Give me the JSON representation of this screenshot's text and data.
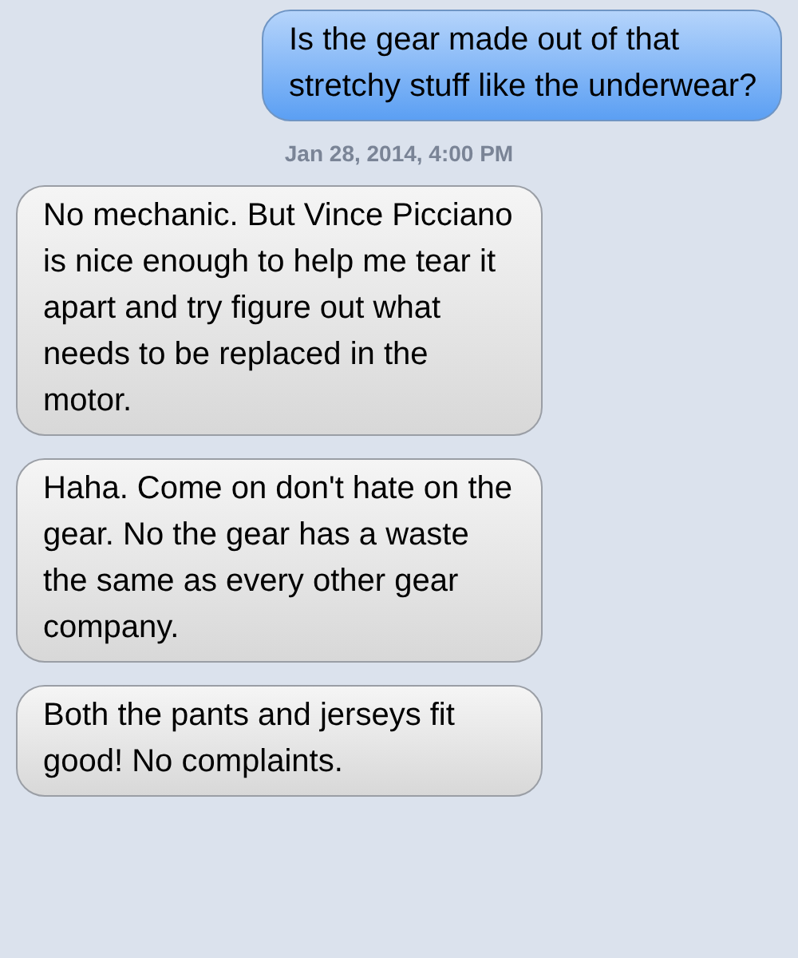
{
  "messages": [
    {
      "kind": "sent",
      "text": "Is the gear made out of that stretchy stuff like the underwear?"
    },
    {
      "kind": "timestamp",
      "text": "Jan 28, 2014, 4:00 PM"
    },
    {
      "kind": "received",
      "text": "No mechanic. But Vince Picciano is nice enough to help me tear it apart and try figure out what needs to be replaced in the motor."
    },
    {
      "kind": "received",
      "text": "Haha. Come on don't hate on the gear. No the gear has a waste the same as every other gear company."
    },
    {
      "kind": "received",
      "text": "Both the pants and jerseys fit good! No complaints."
    }
  ]
}
